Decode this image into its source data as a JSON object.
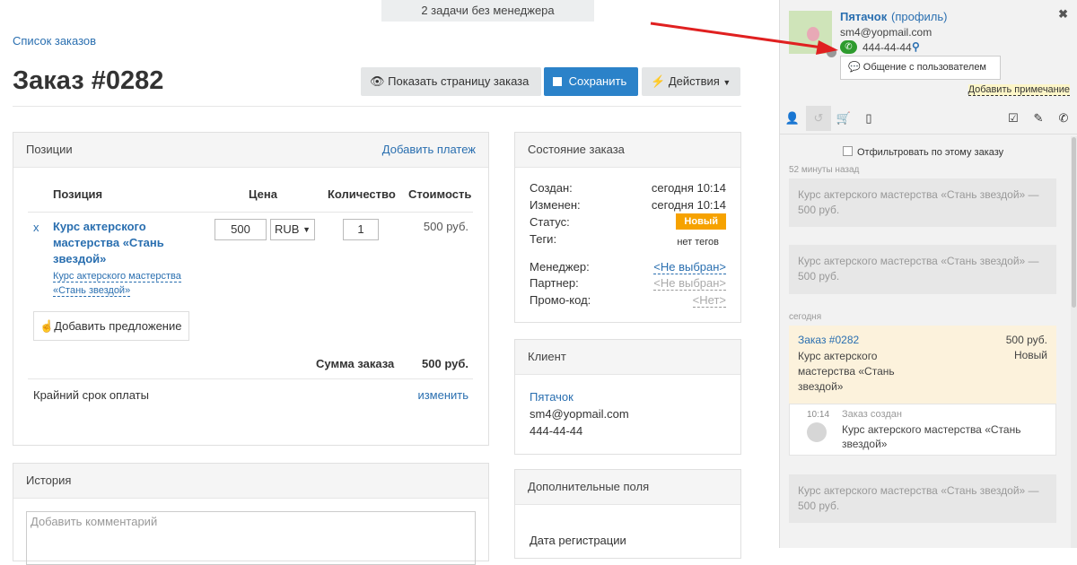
{
  "banner": "2 задачи без менеджера",
  "breadcrumb": "Список заказов",
  "title": "Заказ #0282",
  "toolbar": {
    "show_page": "Показать страницу заказа",
    "save": "Сохранить",
    "actions": "Действия"
  },
  "positions": {
    "header": "Позиции",
    "add_payment": "Добавить платеж",
    "cols": {
      "item": "Позиция",
      "price": "Цена",
      "qty": "Количество",
      "cost": "Стоимость"
    },
    "remove": "x",
    "item_name": "Курс актерского мастерства «Стань звездой»",
    "item_sub": "Курс актерского мастерства «Стань звездой»",
    "price_value": "500",
    "currency": "RUB",
    "qty_value": "1",
    "cost_value": "500 руб.",
    "add_offer": "Добавить предложение",
    "sum_label": "Сумма заказа",
    "sum_value": "500 руб.",
    "deadline_label": "Крайний срок оплаты",
    "deadline_link": "изменить"
  },
  "history": {
    "header": "История",
    "comment_placeholder": "Добавить комментарий"
  },
  "state": {
    "header": "Состояние заказа",
    "created_label": "Создан:",
    "created_value": "сегодня 10:14",
    "changed_label": "Изменен:",
    "changed_value": "сегодня 10:14",
    "status_label": "Статус:",
    "status_value": "Новый",
    "tags_label": "Теги:",
    "tags_value": "нет тегов",
    "manager_label": "Менеджер:",
    "manager_value": "<Не выбран>",
    "partner_label": "Партнер:",
    "partner_value": "<Не выбран>",
    "promo_label": "Промо-код:",
    "promo_value": "<Нет>"
  },
  "client": {
    "header": "Клиент",
    "name": "Пятачок",
    "email": "sm4@yopmail.com",
    "phone": "444-44-44"
  },
  "extra": {
    "header": "Дополнительные поля",
    "reg_date": "Дата регистрации"
  },
  "sidebar": {
    "user_name": "Пятачок",
    "profile_link": "(профиль)",
    "email": "sm4@yopmail.com",
    "phone": "444-44-44",
    "chat_button": "Общение с пользователем",
    "add_note": "Добавить примечание",
    "filter_label": "Отфильтровать по этому заказу",
    "time_ago": "52 минуты назад",
    "today": "сегодня",
    "cards": [
      "Курс актерского мастерства «Стань звездой» — 500 руб.",
      "Курс актерского мастерства «Стань звездой» — 500 руб.",
      "Курс актерского мастерства «Стань звездой» — 500 руб."
    ],
    "order": {
      "title": "Заказ #0282",
      "amount": "500 руб.",
      "desc": "Курс актерского мастерства «Стань звездой»",
      "status": "Новый"
    },
    "event": {
      "time": "10:14",
      "title": "Заказ создан",
      "text": "Курс актерского мастерства «Стань звездой»"
    }
  },
  "colors": {
    "accent": "#2b82c9",
    "status": "#f6a200",
    "phone_green": "#2e9b2e",
    "arrow": "#e02020"
  }
}
